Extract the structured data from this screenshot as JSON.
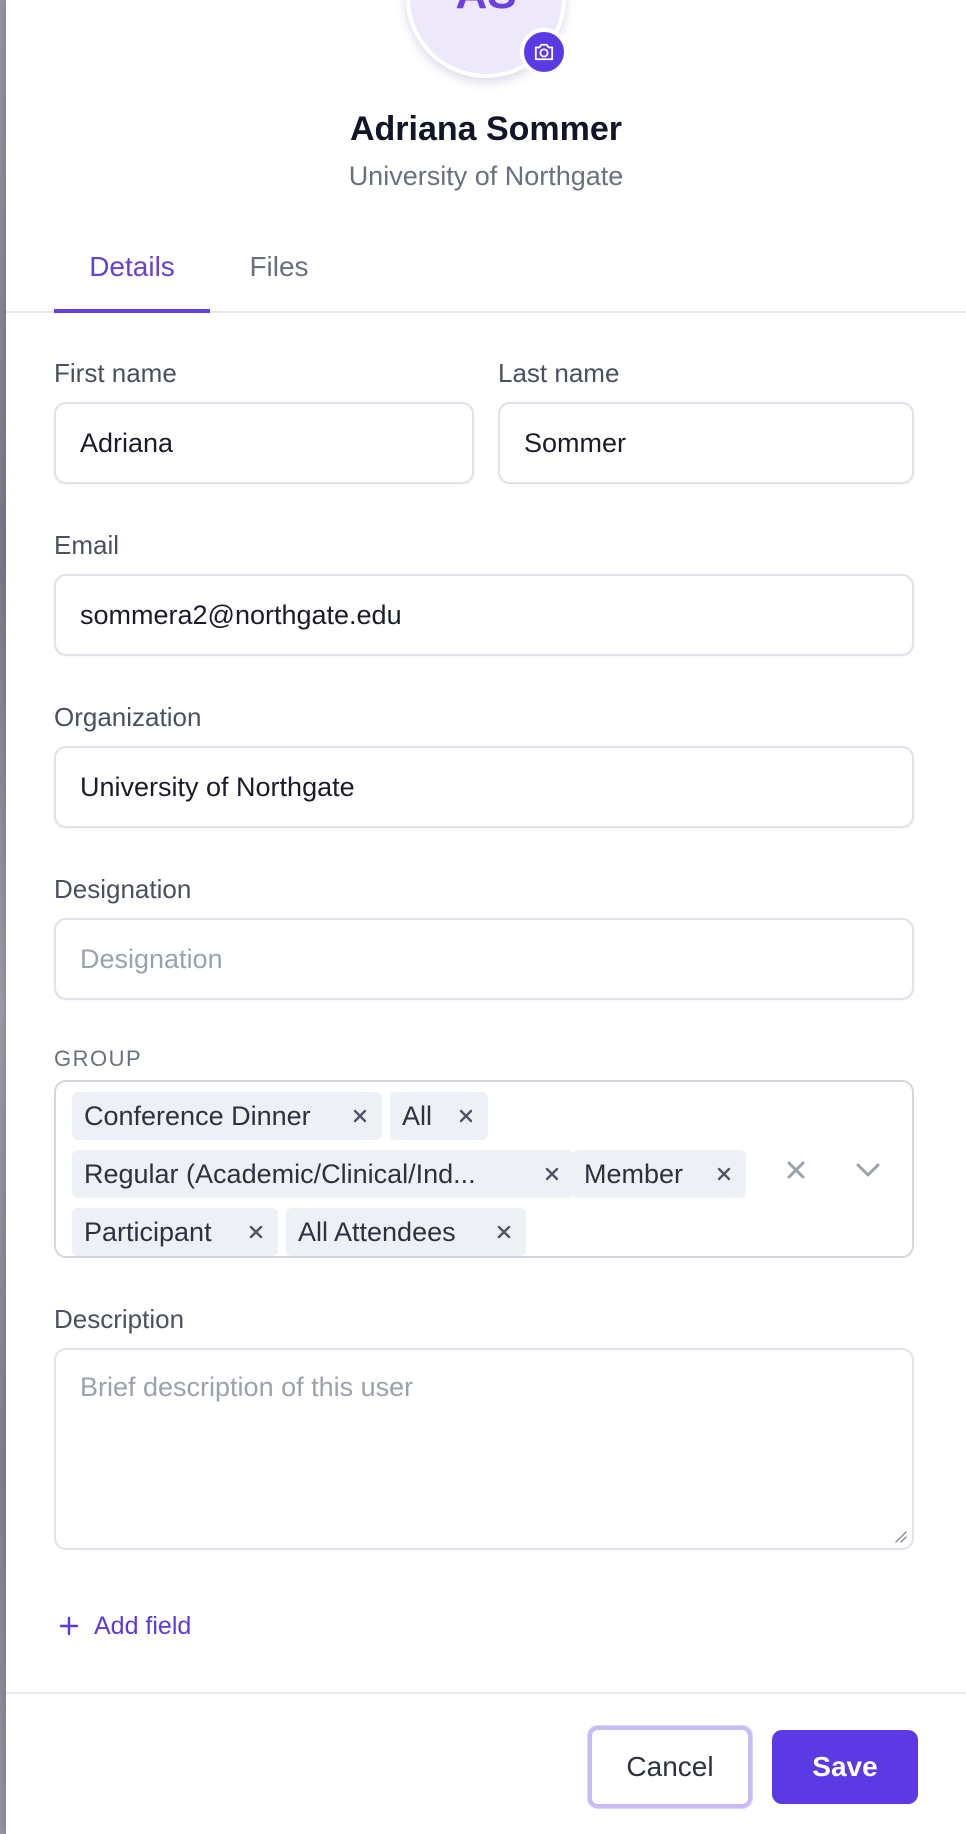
{
  "profile": {
    "initials": "AS",
    "name": "Adriana Sommer",
    "organization": "University of Northgate",
    "avatar_icon": "camera-icon"
  },
  "tabs": [
    {
      "label": "Details",
      "active": true
    },
    {
      "label": "Files",
      "active": false
    }
  ],
  "form": {
    "first_name": {
      "label": "First name",
      "value": "Adriana"
    },
    "last_name": {
      "label": "Last name",
      "value": "Sommer"
    },
    "email": {
      "label": "Email",
      "value": "sommera2@northgate.edu"
    },
    "organization": {
      "label": "Organization",
      "value": "University of Northgate"
    },
    "designation": {
      "label": "Designation",
      "value": "",
      "placeholder": "Designation"
    },
    "group": {
      "label": "GROUP",
      "chips": [
        "Conference Dinner",
        "All",
        "Regular (Academic/Clinical/Ind...",
        "Member",
        "Participant",
        "All Attendees"
      ]
    },
    "description": {
      "label": "Description",
      "value": "",
      "placeholder": "Brief description of this user"
    },
    "add_field_label": "Add field"
  },
  "footer": {
    "cancel_label": "Cancel",
    "save_label": "Save"
  },
  "colors": {
    "accent": "#5b3ae6",
    "avatar_bg": "#ede9fb",
    "chip_bg": "#edf0f4"
  }
}
